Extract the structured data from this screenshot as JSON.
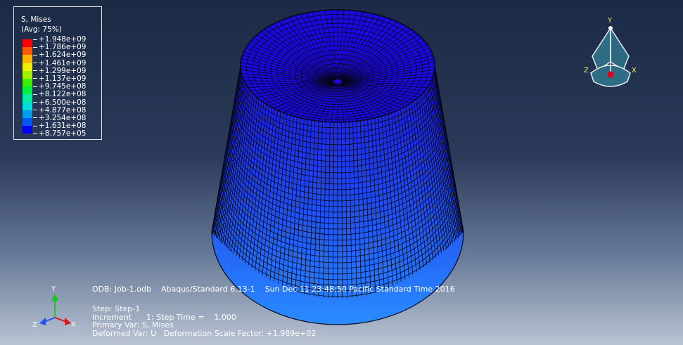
{
  "legend": {
    "title": "S, Mises",
    "subtitle": "(Avg: 75%)",
    "values": [
      "+1.948e+09",
      "+1.786e+09",
      "+1.624e+09",
      "+1.461e+09",
      "+1.299e+09",
      "+1.137e+09",
      "+9.745e+08",
      "+8.122e+08",
      "+6.500e+08",
      "+4.877e+08",
      "+3.254e+08",
      "+1.631e+08",
      "+8.757e+05"
    ],
    "colors": [
      "#ff0000",
      "#ff5a00",
      "#ffb400",
      "#f0f000",
      "#a0f000",
      "#3cf000",
      "#00f03c",
      "#00f0a0",
      "#00dcdc",
      "#009cf0",
      "#005af0",
      "#0000ff"
    ]
  },
  "info": {
    "line1": "ODB: Job-1.odb    Abaqus/Standard 6.13-1    Sun Dec 11 23:48:50 Pacific Standard Time 2016",
    "line2": "Step: Step-1",
    "line3": "Increment      1: Step Time =    1.000",
    "line4": "Primary Var: S, Mises",
    "line5": "Deformed Var: U   Deformation Scale Factor: +1.989e+02"
  },
  "triad": {
    "x": "X",
    "y": "Y",
    "z": "Z"
  },
  "view_cube": {
    "x": "X",
    "y": "Y",
    "z": "Z"
  },
  "model": {
    "color_top": "#1f00e6",
    "color_bottom": "#1a78ff",
    "mesh_color": "#05061a"
  }
}
